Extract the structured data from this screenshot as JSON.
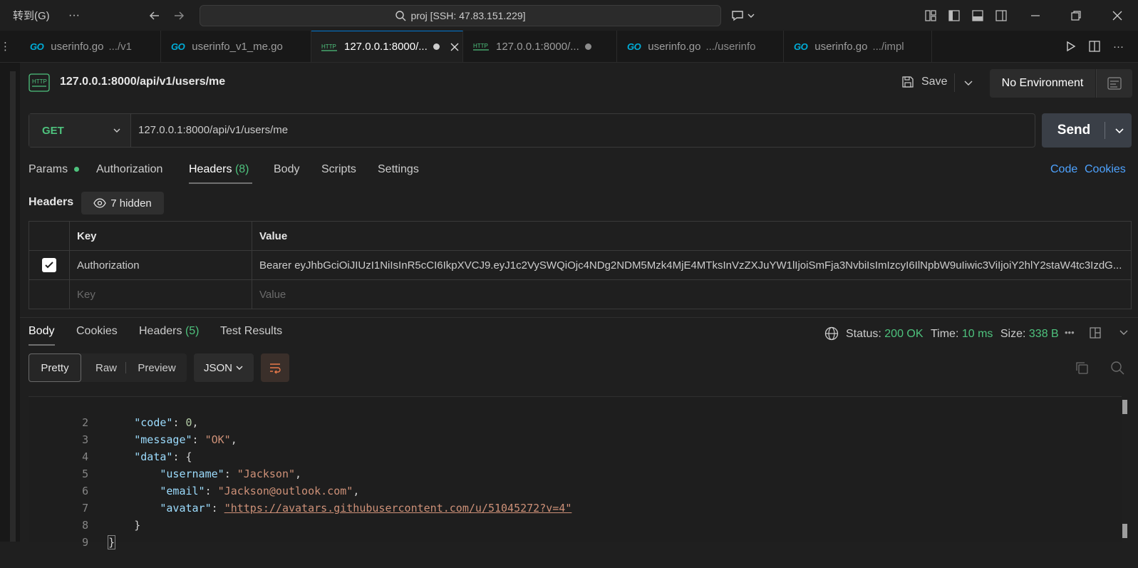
{
  "titlebar": {
    "goto_label": "转到(G)",
    "more": "···",
    "search_text": "proj [SSH: 47.83.151.229]"
  },
  "tabs": [
    {
      "icon": "go-file-icon",
      "name": "userinfo.go",
      "path": ".../v1"
    },
    {
      "icon": "go-file-icon",
      "name": "userinfo_v1_me.go",
      "path": ""
    },
    {
      "icon": "http-file-icon",
      "name": "127.0.0.1:8000/...",
      "path": "",
      "active": true
    },
    {
      "icon": "http-file-icon",
      "name": "127.0.0.1:8000/...",
      "path": ""
    },
    {
      "icon": "go-file-icon",
      "name": "userinfo.go",
      "path": ".../userinfo"
    },
    {
      "icon": "go-file-icon",
      "name": "userinfo.go",
      "path": ".../impl"
    }
  ],
  "tab_icon_labels": {
    "go": "GO",
    "http": "HTTP"
  },
  "request": {
    "title": "127.0.0.1:8000/api/v1/users/me",
    "save_label": "Save",
    "environment": "No Environment",
    "method": "GET",
    "url": "127.0.0.1:8000/api/v1/users/me",
    "send_label": "Send"
  },
  "request_tabs": {
    "params": "Params",
    "authorization": "Authorization",
    "headers": "Headers",
    "headers_count": "(8)",
    "body": "Body",
    "scripts": "Scripts",
    "settings": "Settings",
    "code": "Code",
    "cookies": "Cookies"
  },
  "headers_section": {
    "title": "Headers",
    "hidden_label": "7 hidden",
    "col_key": "Key",
    "col_value": "Value",
    "rows": [
      {
        "checked": true,
        "key": "Authorization",
        "value": "Bearer eyJhbGciOiJIUzI1NiIsInR5cCI6IkpXVCJ9.eyJ1c2VySWQiOjc4NDg2NDM5Mzk4MjE4MTksInVzZXJuYW1lIjoiSmFja3NvbiIsImIzcyI6IlNpbW9uIiwic3ViIjoiY2hlY2staW4tc3IzdG..."
      }
    ],
    "placeholder_key": "Key",
    "placeholder_value": "Value"
  },
  "response_tabs": {
    "body": "Body",
    "cookies": "Cookies",
    "headers": "Headers",
    "headers_count": "(5)",
    "test_results": "Test Results"
  },
  "response_status": {
    "status_label": "Status:",
    "status_value": "200 OK",
    "time_label": "Time:",
    "time_value": "10 ms",
    "size_label": "Size:",
    "size_value": "338 B",
    "more": "•••"
  },
  "view_modes": {
    "pretty": "Pretty",
    "raw": "Raw",
    "preview": "Preview",
    "format": "JSON"
  },
  "code_lines": [
    {
      "n": "2",
      "indent": "    ",
      "key": "\"code\"",
      "sep": ": ",
      "val": "0",
      "vtype": "n",
      "tail": ","
    },
    {
      "n": "3",
      "indent": "    ",
      "key": "\"message\"",
      "sep": ": ",
      "val": "\"OK\"",
      "vtype": "s",
      "tail": ","
    },
    {
      "n": "4",
      "indent": "    ",
      "key": "\"data\"",
      "sep": ": ",
      "val": "{",
      "vtype": "p",
      "tail": ""
    },
    {
      "n": "5",
      "indent": "        ",
      "key": "\"username\"",
      "sep": ": ",
      "val": "\"Jackson\"",
      "vtype": "s",
      "tail": ","
    },
    {
      "n": "6",
      "indent": "        ",
      "key": "\"email\"",
      "sep": ": ",
      "val": "\"Jackson@outlook.com\"",
      "vtype": "s",
      "tail": ","
    },
    {
      "n": "7",
      "indent": "        ",
      "key": "\"avatar\"",
      "sep": ": ",
      "val": "\"https://avatars.githubusercontent.com/u/51045272?v=4\"",
      "vtype": "u",
      "tail": ""
    },
    {
      "n": "8",
      "indent": "    ",
      "key": "",
      "sep": "",
      "val": "}",
      "vtype": "p",
      "tail": ""
    },
    {
      "n": "9",
      "indent": "",
      "key": "",
      "sep": "",
      "val": "}",
      "vtype": "p",
      "tail": ""
    }
  ],
  "colors": {
    "accent_green": "#4ec27d",
    "link_blue": "#4ea3ff",
    "go_blue": "#00add8",
    "format_orange": "#e8794a"
  }
}
